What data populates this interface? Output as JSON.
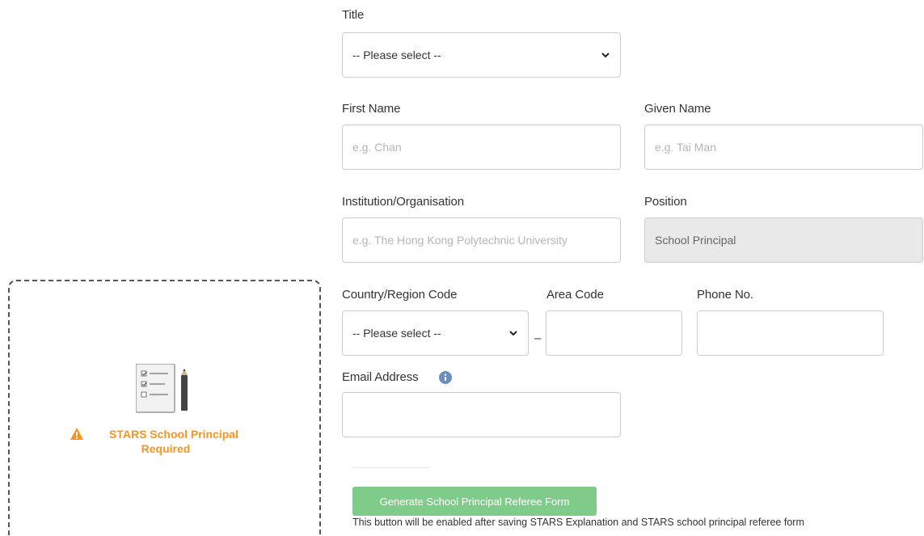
{
  "form": {
    "title": {
      "label": "Title",
      "value": "-- Please select --"
    },
    "first_name": {
      "label": "First Name",
      "placeholder": "e.g. Chan"
    },
    "given_name": {
      "label": "Given Name",
      "placeholder": "e.g. Tai Man"
    },
    "institution": {
      "label": "Institution/Organisation",
      "placeholder": "e.g. The Hong Kong Polytechnic University"
    },
    "position": {
      "label": "Position",
      "value": "School Principal"
    },
    "country_code": {
      "label": "Country/Region Code",
      "value": "-- Please select --"
    },
    "area_code": {
      "label": "Area Code",
      "value": ""
    },
    "phone": {
      "label": "Phone No.",
      "value": ""
    },
    "email": {
      "label": "Email Address",
      "value": ""
    },
    "separator": "–"
  },
  "status_panel": {
    "line1": "STARS School Principal",
    "line2": "Required",
    "icon": "checklist-icon",
    "warning_icon": "warning-icon",
    "accent_color": "#f7941d"
  },
  "actions": {
    "generate_label": "Generate School Principal Referee Form",
    "note": "This button will be enabled after saving STARS Explanation and STARS school principal referee form",
    "button_color": "#7fcc8a"
  }
}
